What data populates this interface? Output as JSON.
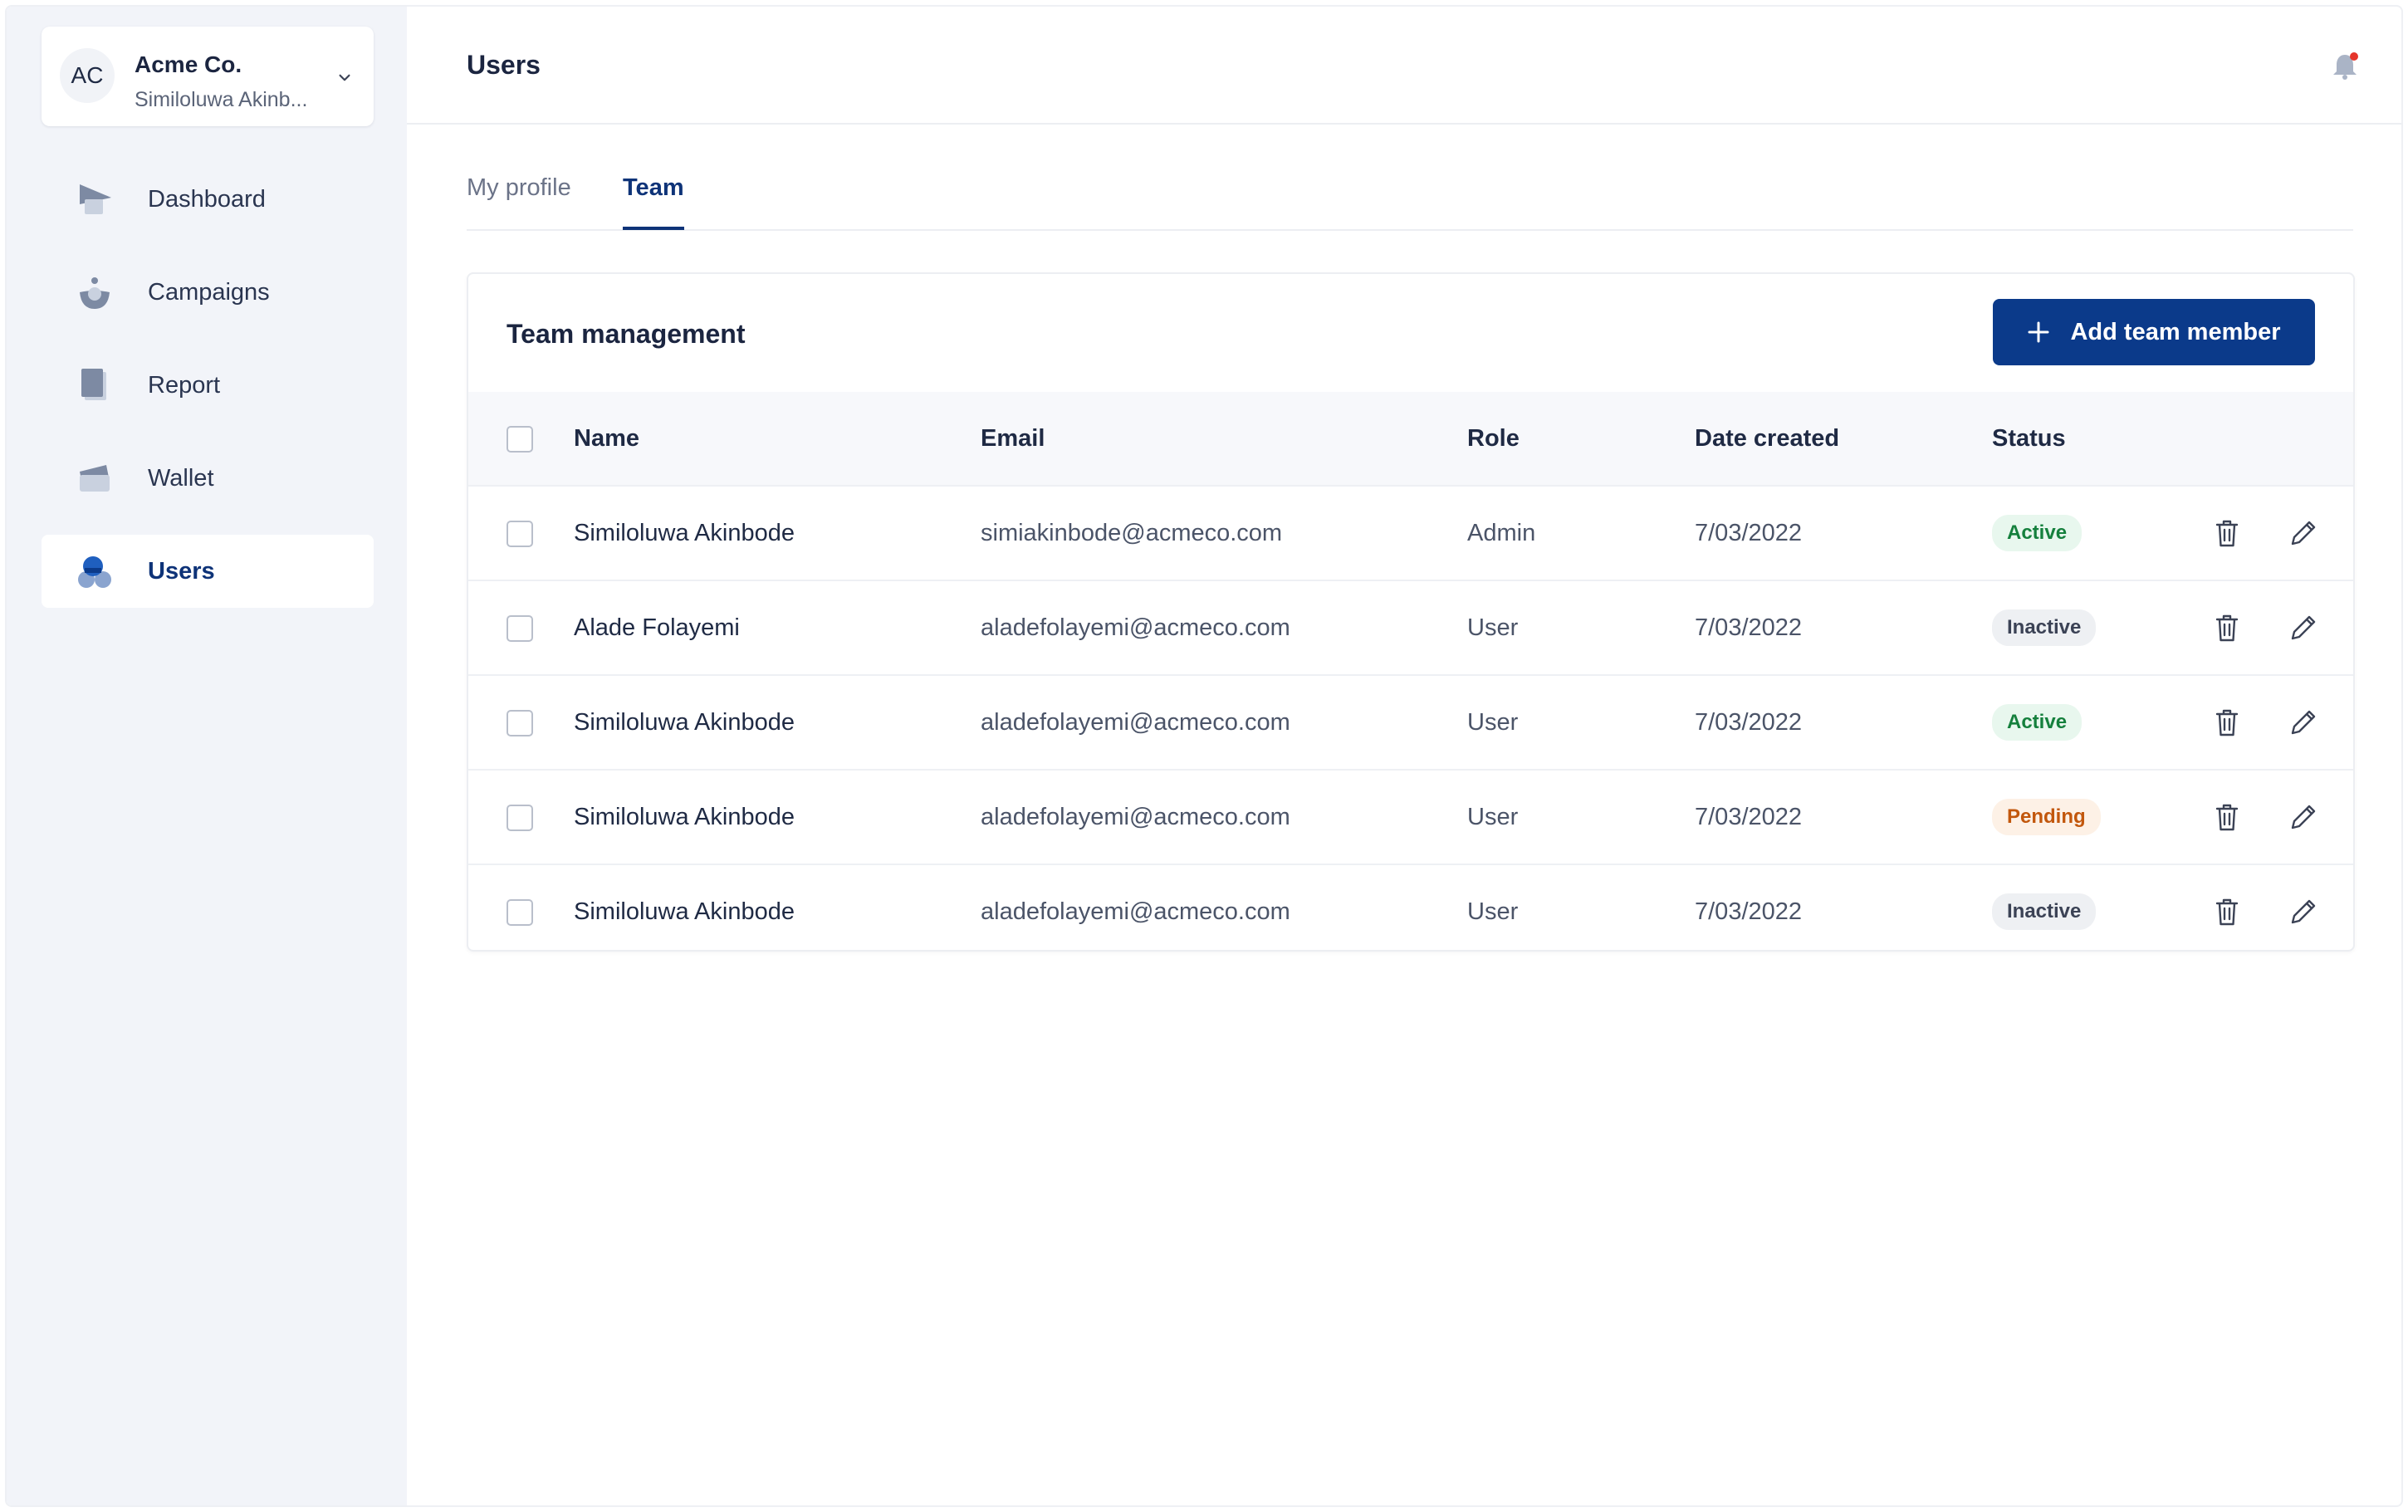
{
  "org": {
    "initials": "AC",
    "name": "Acme Co.",
    "user": "Similoluwa Akinb..."
  },
  "sidebar": {
    "items": [
      {
        "label": "Dashboard",
        "icon": "dashboard-icon",
        "active": false
      },
      {
        "label": "Campaigns",
        "icon": "campaigns-icon",
        "active": false
      },
      {
        "label": "Report",
        "icon": "report-icon",
        "active": false
      },
      {
        "label": "Wallet",
        "icon": "wallet-icon",
        "active": false
      },
      {
        "label": "Users",
        "icon": "users-icon",
        "active": true
      }
    ]
  },
  "header": {
    "title": "Users",
    "notification_icon": "bell-icon",
    "has_unread": true
  },
  "tabs": [
    {
      "label": "My profile",
      "active": false
    },
    {
      "label": "Team",
      "active": true
    }
  ],
  "team": {
    "title": "Team management",
    "add_button_label": "Add team member",
    "columns": [
      "Name",
      "Email",
      "Role",
      "Date created",
      "Status"
    ],
    "rows": [
      {
        "name": "Similoluwa Akinbode",
        "email": "simiakinbode@acmeco.com",
        "role": "Admin",
        "date": "7/03/2022",
        "status": "Active"
      },
      {
        "name": "Alade Folayemi",
        "email": "aladefolayemi@acmeco.com",
        "role": "User",
        "date": "7/03/2022",
        "status": "Inactive"
      },
      {
        "name": "Similoluwa Akinbode",
        "email": "aladefolayemi@acmeco.com",
        "role": "User",
        "date": "7/03/2022",
        "status": "Active"
      },
      {
        "name": "Similoluwa Akinbode",
        "email": "aladefolayemi@acmeco.com",
        "role": "User",
        "date": "7/03/2022",
        "status": "Pending"
      },
      {
        "name": "Similoluwa Akinbode",
        "email": "aladefolayemi@acmeco.com",
        "role": "User",
        "date": "7/03/2022",
        "status": "Inactive"
      }
    ]
  },
  "colors": {
    "accent": "#0b3a8a",
    "sidebar_bg": "#f2f4f9",
    "status_active": "#15803d",
    "status_inactive": "#3b4255",
    "status_pending": "#c2570c",
    "notification_dot": "#e5352b"
  }
}
